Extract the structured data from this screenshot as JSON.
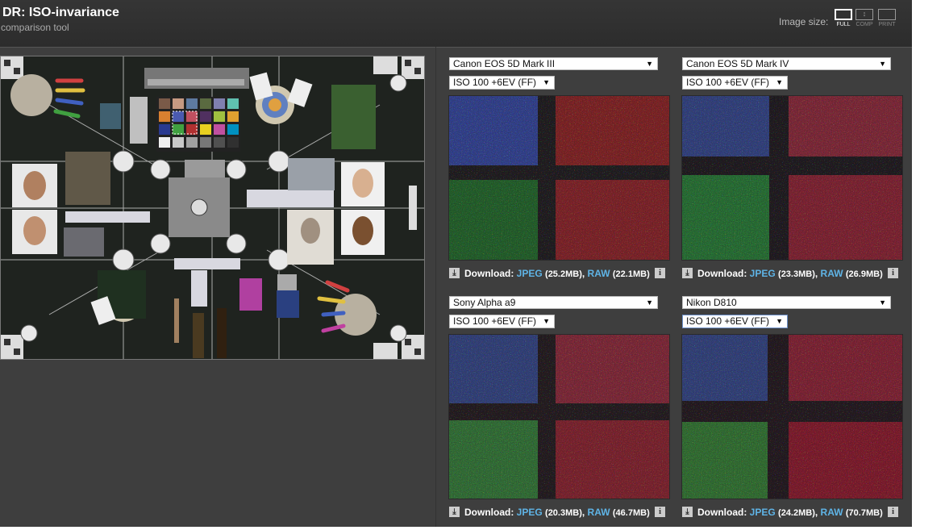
{
  "header": {
    "title": "DR: ISO-invariance",
    "subtitle": "comparison tool",
    "image_size_label": "Image size:",
    "size_options": [
      "FULL",
      "COMP",
      "PRINT"
    ],
    "active_size": "FULL"
  },
  "panels": [
    {
      "camera": "Canon EOS 5D Mark III",
      "setting": "ISO 100 +6EV (FF)",
      "download_label": "Download:",
      "jpeg_label": "JPEG",
      "jpeg_size": "(25.2MB)",
      "raw_label": "RAW",
      "raw_size": "(22.1MB)"
    },
    {
      "camera": "Canon EOS 5D Mark IV",
      "setting": "ISO 100 +6EV (FF)",
      "download_label": "Download:",
      "jpeg_label": "JPEG",
      "jpeg_size": "(23.3MB)",
      "raw_label": "RAW",
      "raw_size": "(26.9MB)"
    },
    {
      "camera": "Sony Alpha a9",
      "setting": "ISO 100 +6EV (FF)",
      "download_label": "Download:",
      "jpeg_label": "JPEG",
      "jpeg_size": "(20.3MB)",
      "raw_label": "RAW",
      "raw_size": "(46.7MB)"
    },
    {
      "camera": "Nikon D810",
      "setting": "ISO 100 +6EV (FF)",
      "download_label": "Download:",
      "jpeg_label": "JPEG",
      "jpeg_size": "(24.2MB)",
      "raw_label": "RAW",
      "raw_size": "(70.7MB)"
    }
  ],
  "icons": {
    "download": "download-icon",
    "info": "info-icon",
    "dropdown": "chevron-down-icon"
  },
  "colors": {
    "background": "#3e3e3e",
    "link": "#5fb4e6",
    "header": "#2f2f2f"
  }
}
